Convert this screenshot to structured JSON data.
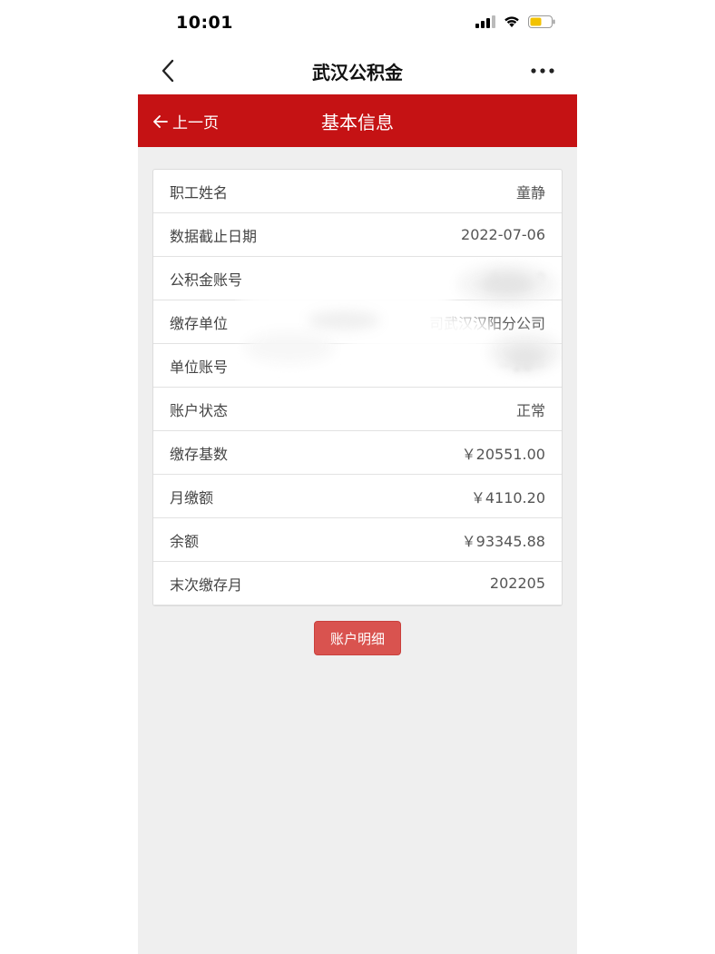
{
  "status_bar": {
    "time": "10:01"
  },
  "nav_bar": {
    "title": "武汉公积金",
    "back_icon": "chevron-left-icon",
    "more_icon": "more-dots-icon"
  },
  "header": {
    "prev_label": "上一页",
    "title": "基本信息"
  },
  "info_rows": [
    {
      "label": "职工姓名",
      "value": "童静"
    },
    {
      "label": "数据截止日期",
      "value": "2022-07-06"
    },
    {
      "label": "公积金账号",
      "value": "8········0"
    },
    {
      "label": "缴存单位",
      "value": "司武汉汉阳分公司"
    },
    {
      "label": "单位账号",
      "value": "···26···"
    },
    {
      "label": "账户状态",
      "value": "正常"
    },
    {
      "label": "缴存基数",
      "value": "￥20551.00"
    },
    {
      "label": "月缴额",
      "value": "￥4110.20"
    },
    {
      "label": "余额",
      "value": "￥93345.88"
    },
    {
      "label": "末次缴存月",
      "value": "202205"
    }
  ],
  "actions": {
    "detail_button": "账户明细"
  },
  "colors": {
    "header_red": "#c51214",
    "button_red": "#d9534f",
    "background": "#efefef"
  }
}
